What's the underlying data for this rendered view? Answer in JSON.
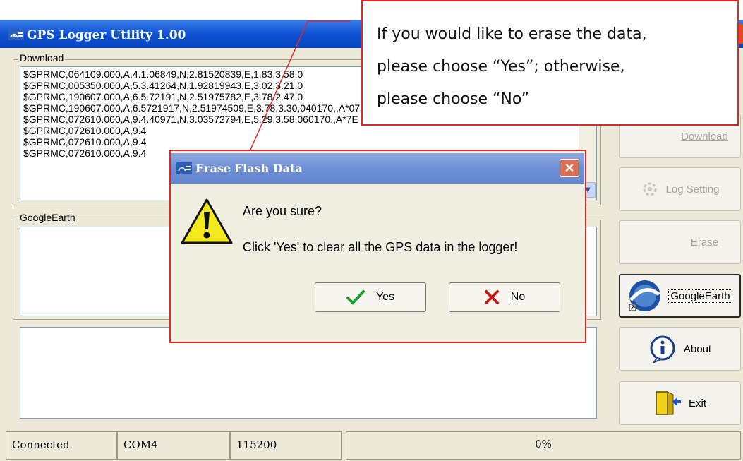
{
  "window": {
    "title": "GPS Logger Utility 1.00"
  },
  "download": {
    "legend": "Download",
    "lines": [
      "$GPRMC,064109.000,A,4.1.06849,N,2.81520839,E,1.83,3.58,0",
      "$GPRMC,005350.000,A,5.3.41264,N,1.92819943,E,3.02,3.21,0",
      "$GPRMC,190607.000,A,6.5.72191,N,2.51975782,E,3.78,2.47,0",
      "$GPRMC,190607.000,A,6.5721917,N,2.51974509,E,3.78,3.30,040170,,A*07",
      "$GPRMC,072610.000,A,9.4.40971,N,3.03572794,E,5.29,3.58,060170,,A*7E",
      "$GPRMC,072610.000,A,9.4",
      "$GPRMC,072610.000,A,9.4",
      "$GPRMC,072610.000,A,9.4"
    ]
  },
  "googleearth": {
    "legend": "GoogleEarth"
  },
  "side_buttons": {
    "download": "Download",
    "log_setting": "Log Setting",
    "erase": "Erase",
    "googleearth": "GoogleEarth",
    "about": "About",
    "exit": "Exit"
  },
  "status": {
    "connection": "Connected",
    "port": "COM4",
    "baud": "115200",
    "progress": "0%",
    "progress_value": 0
  },
  "dialog": {
    "title": "Erase Flash Data",
    "question": "Are you sure?",
    "message": "Click 'Yes' to clear all the GPS data in the logger!",
    "yes": "Yes",
    "no": "No"
  },
  "callout": {
    "line1": "If you would like to erase the data,",
    "line2": "please choose “Yes”; otherwise,",
    "line3": "please choose “No”"
  },
  "colors": {
    "annotation": "#e32424",
    "titlebar": "#0b4fd1"
  },
  "icons": [
    "app-icon",
    "warning-icon",
    "checkmark-icon",
    "x-icon",
    "google-earth-icon",
    "info-icon",
    "exit-door-icon",
    "log-setting-icon",
    "dialog-close-icon"
  ]
}
